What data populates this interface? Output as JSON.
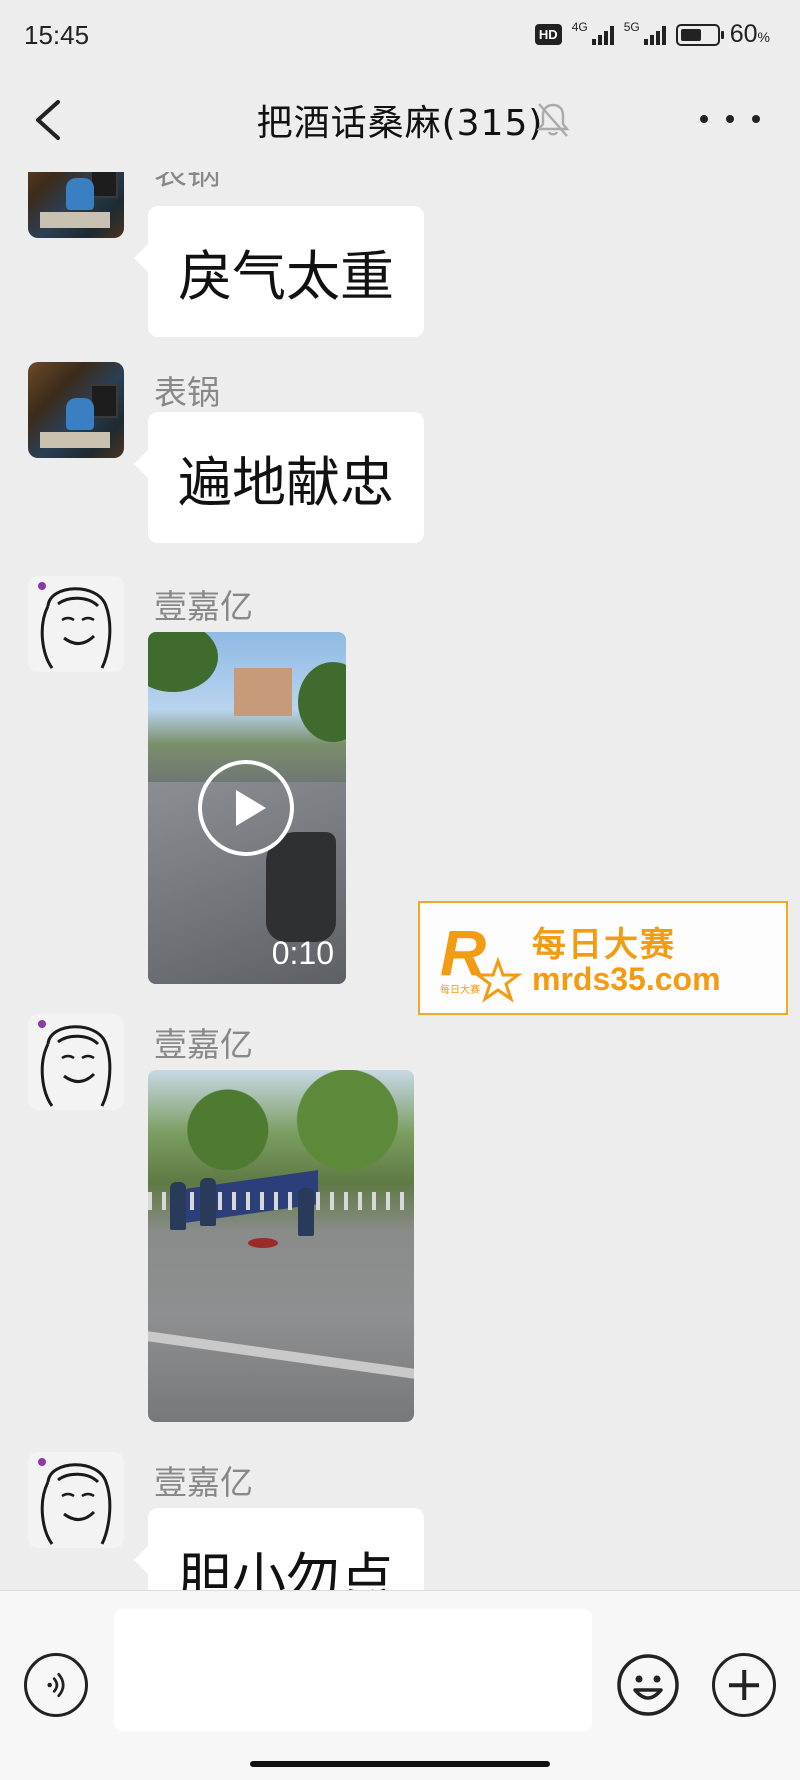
{
  "status_bar": {
    "time": "15:45",
    "hd_badge": "HD",
    "network_1": "4G",
    "network_2": "5G",
    "battery_percent": "60",
    "battery_unit": "%",
    "battery_level": 0.6
  },
  "header": {
    "title": "把酒话桑麻(315)",
    "back_icon": "chevron-left-icon",
    "mute_icon": "bell-muted-icon",
    "more_icon": "more-dots-icon"
  },
  "messages": [
    {
      "sender": "表锅",
      "type": "text",
      "text": "戾气太重"
    },
    {
      "sender": "表锅",
      "type": "text",
      "text": "遍地献忠"
    },
    {
      "sender": "壹嘉亿",
      "type": "video",
      "duration": "0:10"
    },
    {
      "sender": "壹嘉亿",
      "type": "image"
    },
    {
      "sender": "壹嘉亿",
      "type": "text",
      "text": "胆小勿点"
    }
  ],
  "watermark": {
    "logo_letter": "R",
    "logo_sub": "每日大赛",
    "name": "每日大赛",
    "url": "mrds35.com"
  },
  "input_bar": {
    "voice_icon": "voice-icon",
    "message_value": "",
    "emoji_icon": "emoji-icon",
    "plus_icon": "plus-icon"
  },
  "colors": {
    "background": "#ededed",
    "bubble": "#ffffff",
    "watermark_accent": "#f39c12"
  }
}
